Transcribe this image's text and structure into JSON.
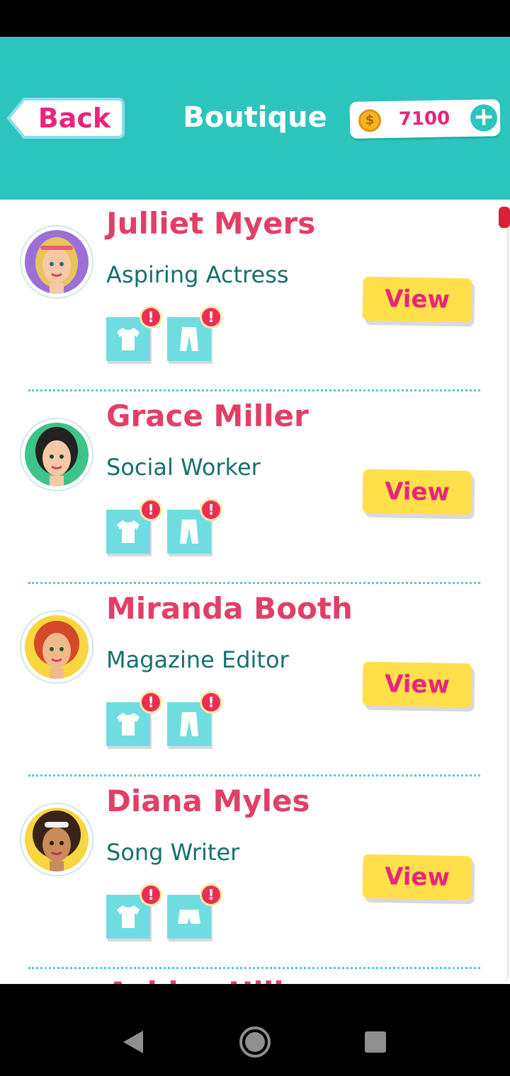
{
  "header": {
    "back_label": "Back",
    "title": "Boutique",
    "coins": "7100",
    "coin_symbol": "$",
    "add_symbol": "+"
  },
  "clients": [
    {
      "name": "Julliet Myers",
      "role": "Aspiring Actress",
      "view_label": "View",
      "items": [
        "shirt-icon",
        "pants-icon"
      ],
      "avatar_bg": "#9b6fd6",
      "hair": "#e8c45a"
    },
    {
      "name": "Grace Miller",
      "role": "Social Worker",
      "view_label": "View",
      "items": [
        "shirt-icon",
        "pants-icon"
      ],
      "avatar_bg": "#3ec48a",
      "hair": "#222222"
    },
    {
      "name": "Miranda Booth",
      "role": "Magazine Editor",
      "view_label": "View",
      "items": [
        "shirt-icon",
        "pants-icon"
      ],
      "avatar_bg": "#f7d640",
      "hair": "#d5482a"
    },
    {
      "name": "Diana Myles",
      "role": "Song Writer",
      "view_label": "View",
      "items": [
        "shirt-icon",
        "shorts-icon"
      ],
      "avatar_bg": "#f7d640",
      "hair": "#3a2418"
    }
  ],
  "partial_next": "Ashley Hill",
  "alert_symbol": "!",
  "colors": {
    "header_bg": "#2cc5bd",
    "accent_pink": "#e8257a",
    "view_btn": "#ffe04a",
    "slot_bg": "#6fdde0"
  }
}
